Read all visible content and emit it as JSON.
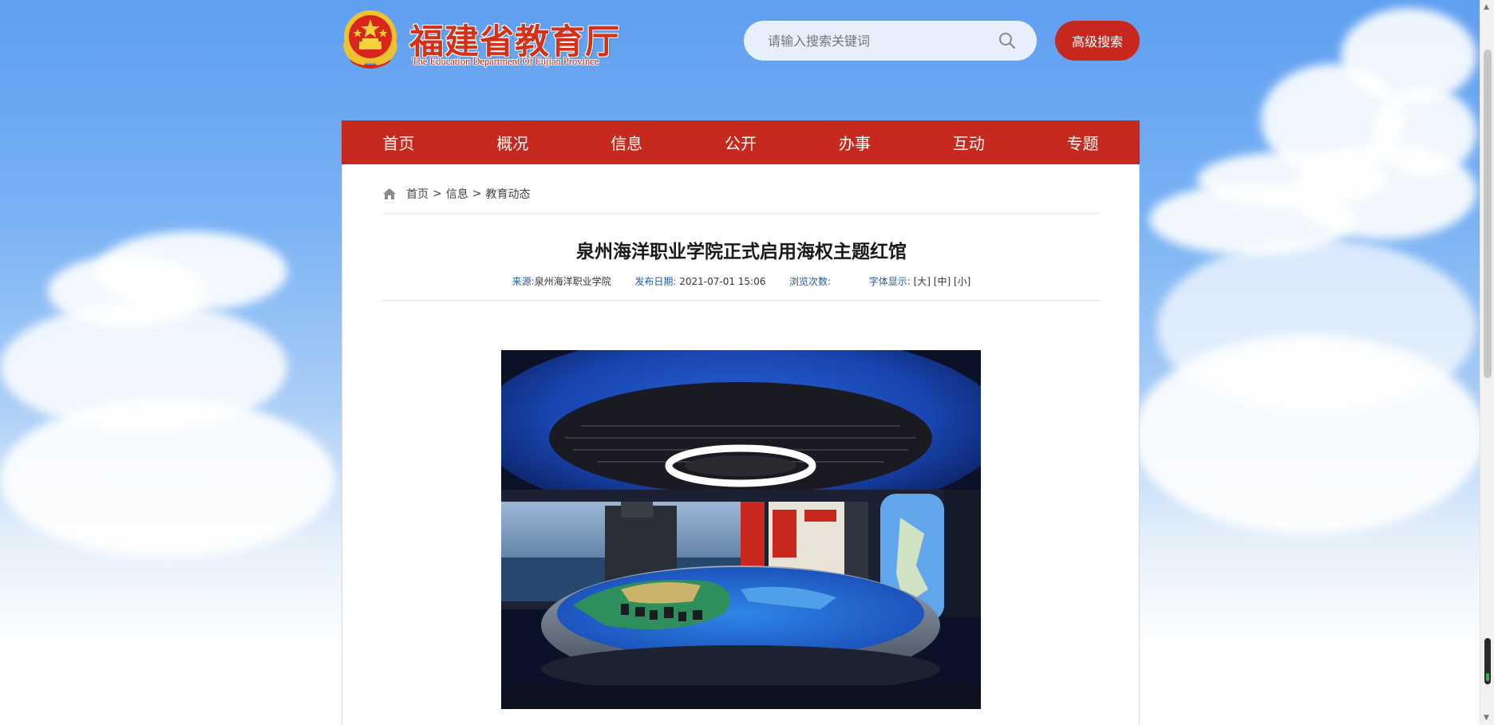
{
  "header": {
    "logo_title": "福建省教育厅",
    "logo_subtitle": "The Education Department Of Fujian Province",
    "search_placeholder": "请输入搜索关键词",
    "advanced_search_label": "高级搜索"
  },
  "nav": {
    "items": [
      "首页",
      "概况",
      "信息",
      "公开",
      "办事",
      "互动",
      "专题"
    ]
  },
  "breadcrumb": {
    "items": [
      "首页",
      "信息",
      "教育动态"
    ],
    "separator": ">"
  },
  "article": {
    "title": "泉州海洋职业学院正式启用海权主题红馆",
    "source_label": "来源:",
    "source_value": "泉州海洋职业学院",
    "date_label": "发布日期:",
    "date_value": "2021-07-01 15:06",
    "views_label": "浏览次数:",
    "views_value": "",
    "font_label": "字体显示:",
    "font_large": "[大]",
    "font_medium": "[中]",
    "font_small": "[小]"
  },
  "colors": {
    "brand_red": "#c62a1f",
    "link_blue": "#1f5aa8"
  }
}
